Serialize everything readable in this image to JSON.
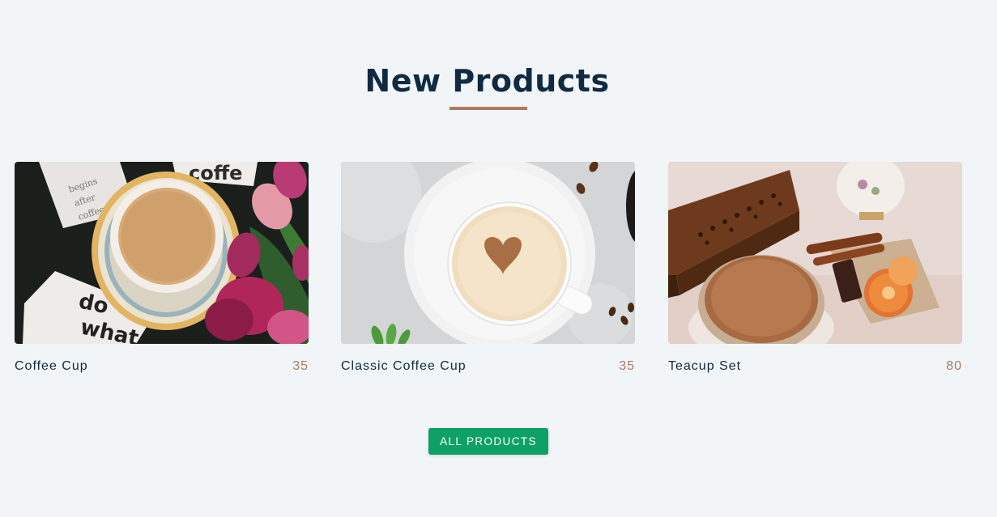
{
  "section": {
    "title": "New Products"
  },
  "products": [
    {
      "name": "Coffee Cup",
      "price": "35",
      "image_icon": "tea-cup-with-tulips-photo"
    },
    {
      "name": "Classic Coffee Cup",
      "price": "35",
      "image_icon": "cappuccino-cup-photo"
    },
    {
      "name": "Teacup Set",
      "price": "80",
      "image_icon": "teacup-set-with-wooden-box-photo"
    }
  ],
  "actions": {
    "all_products_label": "ALL PRODUCTS"
  },
  "colors": {
    "background": "#f1f5f8",
    "heading": "#102a42",
    "accent": "#ab7a5f",
    "button": "#0ea165"
  }
}
